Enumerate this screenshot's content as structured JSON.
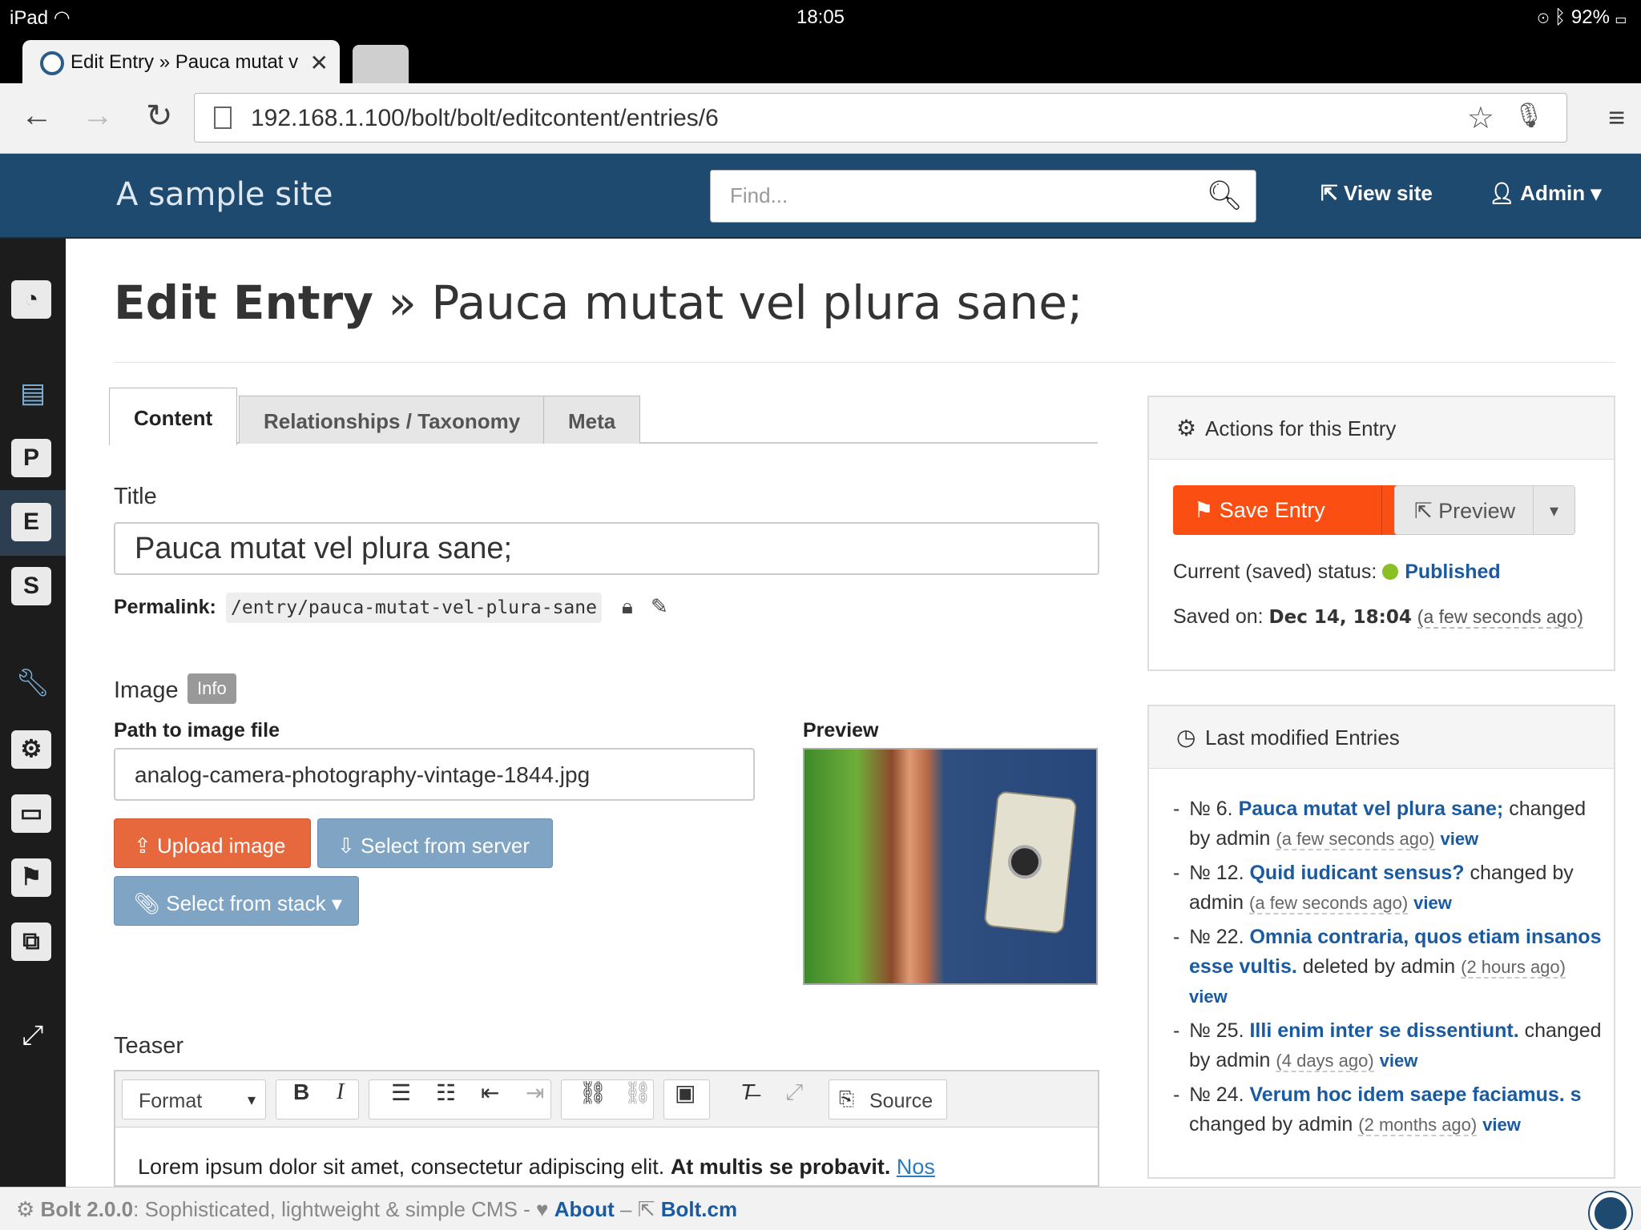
{
  "statusbar": {
    "device": "iPad",
    "time": "18:05",
    "battery": "92%"
  },
  "browser": {
    "tab_title": "Edit Entry » Pauca mutat v",
    "url": "192.168.1.100/bolt/bolt/editcontent/entries/6"
  },
  "header": {
    "site_title": "A sample site",
    "search_placeholder": "Find...",
    "view_site": "View site",
    "admin": "Admin"
  },
  "sidebar": {
    "items": [
      {
        "icon": "dashboard-icon"
      },
      {
        "icon": "document-icon"
      },
      {
        "label": "P"
      },
      {
        "label": "E"
      },
      {
        "label": "S"
      },
      {
        "icon": "wrench-icon"
      },
      {
        "icon": "gears-icon"
      },
      {
        "icon": "folder-icon"
      },
      {
        "icon": "flag-icon"
      },
      {
        "icon": "cubes-icon"
      },
      {
        "icon": "expand-icon"
      }
    ]
  },
  "page": {
    "title_strong": "Edit Entry",
    "title_rest": "» Pauca mutat vel plura sane;",
    "tabs": [
      "Content",
      "Relationships / Taxonomy",
      "Meta"
    ],
    "title_label": "Title",
    "title_value": "Pauca mutat vel plura sane;",
    "permalink_label": "Permalink:",
    "permalink_value": "/entry/pauca-mutat-vel-plura-sane",
    "image_label": "Image",
    "info_badge": "Info",
    "path_label": "Path to image file",
    "path_value": "analog-camera-photography-vintage-1844.jpg",
    "preview_label": "Preview",
    "upload_button": "Upload image",
    "select_server_button": "Select from server",
    "select_stack_button": "Select from stack",
    "teaser_label": "Teaser",
    "editor": {
      "format": "Format",
      "source": "Source",
      "text_plain": "Lorem ipsum dolor sit amet, consectetur adipiscing elit.",
      "text_bold": "At multis se probavit.",
      "text_link": "Nos"
    }
  },
  "actions_panel": {
    "heading": "Actions for this Entry",
    "save_button": "Save Entry",
    "preview_button": "Preview",
    "status_label": "Current (saved) status:",
    "status_value": "Published",
    "saved_label": "Saved on:",
    "saved_value": "Dec 14, 18:04",
    "saved_relative": "(a few seconds ago)",
    "colors": {
      "save": "#fa4e12",
      "published_dot": "#8bbf25"
    }
  },
  "recent_panel": {
    "heading": "Last modified Entries",
    "entries": [
      {
        "num": "№ 6.",
        "title": "Pauca mutat vel plura sane;",
        "action": "changed by admin",
        "when": "(a few seconds ago)",
        "view": "view"
      },
      {
        "num": "№ 12.",
        "title": "Quid iudicant sensus?",
        "action": "changed by admin",
        "when": "(a few seconds ago)",
        "view": "view"
      },
      {
        "num": "№ 22.",
        "title": "Omnia contraria, quos etiam insanos esse vultis.",
        "action": "deleted by admin",
        "when": "(2 hours ago)",
        "view": "view"
      },
      {
        "num": "№ 25.",
        "title": "Illi enim inter se dissentiunt.",
        "action": "changed by admin",
        "when": "(4 days ago)",
        "view": "view"
      },
      {
        "num": "№ 24.",
        "title": "Verum hoc idem saepe faciamus. s",
        "action": "changed by admin",
        "when": "(2 months ago)",
        "view": "view"
      }
    ]
  },
  "footer": {
    "product": "Bolt 2.0.0",
    "tagline": ": Sophisticated, lightweight & simple CMS -",
    "about": "About",
    "sep": "–",
    "site": "Bolt.cm"
  }
}
